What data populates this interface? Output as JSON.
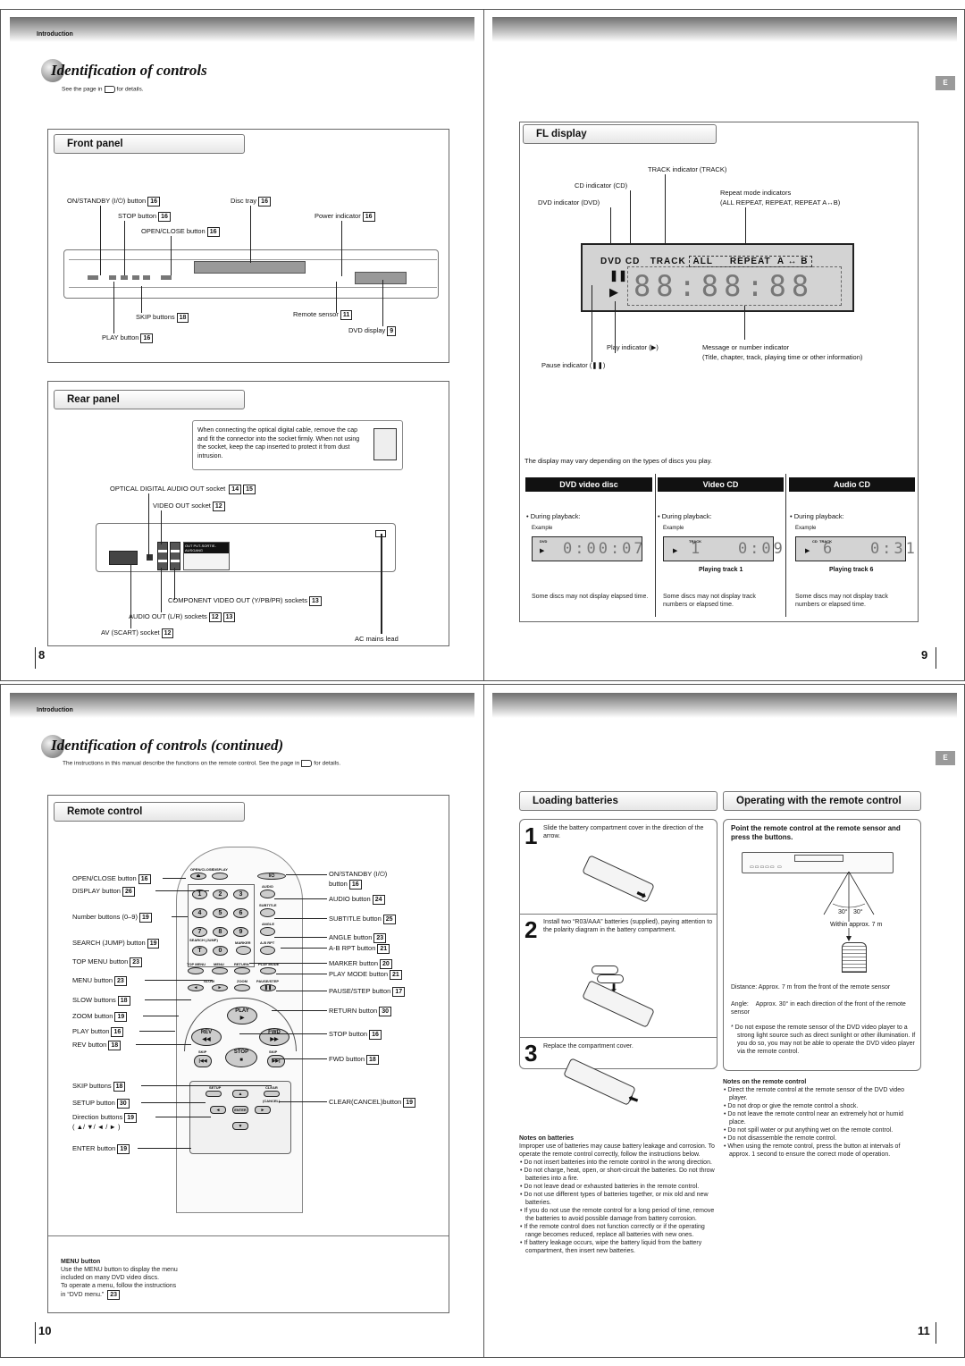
{
  "page8": {
    "header_label": "Introduction",
    "title": "Identification of controls",
    "subtitle_pre": "See the page in",
    "subtitle_post": "for details.",
    "page_number": "8",
    "front_panel": {
      "heading": "Front panel",
      "labels": [
        {
          "text": "ON/STANDBY (I/⏻) button",
          "ref": "16"
        },
        {
          "text": "Disc tray",
          "ref": "16"
        },
        {
          "text": "STOP button",
          "ref": "16"
        },
        {
          "text": "Power indicator",
          "ref": "16"
        },
        {
          "text": "OPEN/CLOSE button",
          "ref": "16"
        },
        {
          "text": "Remote sensor",
          "ref": "11"
        },
        {
          "text": "SKIP buttons",
          "ref": "18"
        },
        {
          "text": "DVD display",
          "ref": "9"
        },
        {
          "text": "PLAY button",
          "ref": "16"
        }
      ]
    },
    "rear_panel": {
      "heading": "Rear panel",
      "note": "When connecting the optical digital cable, remove the cap and fit the connector into the socket firmly. When not using the socket, keep the cap inserted to protect it from dust intrusion.",
      "panel_label": "OUT PUT-SORTIE-AUSGANG",
      "labels": [
        {
          "text": "OPTICAL DIGITAL AUDIO OUT socket",
          "ref": "14",
          "ref2": "15"
        },
        {
          "text": "VIDEO OUT socket",
          "ref": "12"
        },
        {
          "text": "COMPONENT VIDEO OUT (Y/PB/PR) sockets",
          "ref": "13"
        },
        {
          "text": "AUDIO OUT (L/R) sockets",
          "ref": "12",
          "ref2": "13"
        },
        {
          "text": "AV (SCART) socket",
          "ref": "12"
        },
        {
          "text": "AC mains lead"
        }
      ]
    }
  },
  "page9": {
    "page_number": "9",
    "lang_tab": "E",
    "fl_display": {
      "heading": "FL display",
      "indicators": {
        "dvd": "DVD",
        "cd": "CD",
        "track": "TRACK",
        "all": "ALL",
        "repeat": "REPEAT",
        "ab": "A ↔ B",
        "digits": "88:88:88"
      },
      "labels": {
        "track": "TRACK indicator (TRACK)",
        "cd": "CD indicator (CD)",
        "dvd": "DVD indicator (DVD)",
        "repeat1": "Repeat mode indicators",
        "repeat2": "(ALL REPEAT, REPEAT, REPEAT A↔B)",
        "play": "Play indicator (▶)",
        "message1": "Message or number indicator",
        "message2": "(Title, chapter, track, playing time or other information)",
        "pause": "Pause indicator (❚❚)"
      },
      "vary_note": "The display may vary depending on the types of discs you play.",
      "discs": [
        {
          "name": "DVD video disc",
          "during": "During playback:",
          "example": "Example",
          "small_ind": "DVD",
          "display": "0:00:07",
          "caption": "",
          "note": "Some discs may not display elapsed time."
        },
        {
          "name": "Video CD",
          "during": "During playback:",
          "example": "Example",
          "small_ind": "TRACK",
          "display": "1   0:09",
          "caption": "Playing track 1",
          "note": "Some discs may not display track numbers or elapsed time."
        },
        {
          "name": "Audio CD",
          "during": "During playback:",
          "example": "Example",
          "small_ind": "CD  TRACK",
          "display": "6   0:31",
          "caption": "Playing track 6",
          "note": "Some discs may not display track numbers or elapsed time."
        }
      ]
    }
  },
  "page10": {
    "header_label": "Introduction",
    "title": "Identification of controls (continued)",
    "subtitle_pre": "The instructions in this manual describe the functions on the remote control. See the page in",
    "subtitle_post": "for details.",
    "page_number": "10",
    "remote": {
      "heading": "Remote control",
      "left_labels": [
        {
          "text": "OPEN/CLOSE button",
          "ref": "16"
        },
        {
          "text": "DISPLAY button",
          "ref": "26"
        },
        {
          "text": "Number buttons (0–9)",
          "ref": "19"
        },
        {
          "text": "SEARCH (JUMP) button",
          "ref": "19"
        },
        {
          "text": "TOP MENU button",
          "ref": "23"
        },
        {
          "text": "MENU button",
          "ref": "23"
        },
        {
          "text": "SLOW buttons",
          "ref": "18"
        },
        {
          "text": "ZOOM button",
          "ref": "19"
        },
        {
          "text": "PLAY button",
          "ref": "16"
        },
        {
          "text": "REV button",
          "ref": "18"
        },
        {
          "text": "SKIP buttons",
          "ref": "18"
        },
        {
          "text": "SETUP button",
          "ref": "30"
        },
        {
          "text": "Direction buttons",
          "ref": "19",
          "extra": "( ▲/ ▼/ ◄ / ► )"
        },
        {
          "text": "ENTER button",
          "ref": "19"
        }
      ],
      "right_labels": [
        {
          "text": "ON/STANDBY (I/⏻)",
          "text2": "button",
          "ref": "16"
        },
        {
          "text": "AUDIO button",
          "ref": "24"
        },
        {
          "text": "SUBTITLE button",
          "ref": "25"
        },
        {
          "text": "ANGLE button",
          "ref": "23"
        },
        {
          "text": "A-B RPT button",
          "ref": "21"
        },
        {
          "text": "MARKER button",
          "ref": "20"
        },
        {
          "text": "PLAY MODE button",
          "ref": "21"
        },
        {
          "text": "PAUSE/STEP button",
          "ref": "17"
        },
        {
          "text": "RETURN button",
          "ref": "30"
        },
        {
          "text": "STOP button",
          "ref": "16"
        },
        {
          "text": "FWD button",
          "ref": "18"
        },
        {
          "text": "CLEAR(CANCEL)button",
          "ref": "19"
        }
      ],
      "keys": {
        "open_close": "OPEN/CLOSE",
        "display": "DISPLAY",
        "audio": "AUDIO",
        "subtitle": "SUBTITLE",
        "angle": "ANGLE",
        "search": "SEARCH (JUMP)",
        "marker": "MARKER",
        "abrpt": "A-B RPT",
        "topmenu": "TOP MENU",
        "menu": "MENU",
        "return": "RETURN",
        "playmode": "PLAY MODE",
        "slow": "SLOW",
        "zoom": "ZOOM",
        "pausestep": "PAUSE/STEP",
        "play": "PLAY",
        "rev": "REV",
        "fwd": "FWD",
        "stop": "STOP",
        "skip": "SKIP",
        "setup": "SETUP",
        "clear": "CLEAR",
        "cancel": "(CANCEL)",
        "enter": "ENTER",
        "digits": [
          "1",
          "2",
          "3",
          "4",
          "5",
          "6",
          "7",
          "8",
          "9",
          "0"
        ],
        "t": "T",
        "standby": "I/⏻"
      },
      "menu_note": {
        "title": "MENU button",
        "lines": [
          "Use the MENU button to display the menu",
          "included on many DVD video discs.",
          "To operate a menu, follow the instructions",
          "in “DVD menu.”"
        ],
        "ref": "23"
      }
    }
  },
  "page11": {
    "page_number": "11",
    "lang_tab": "E",
    "loading": {
      "heading": "Loading batteries",
      "steps": [
        {
          "num": "1",
          "text": "Slide the battery compartment cover in the direction of the arrow."
        },
        {
          "num": "2",
          "text": "Install two “R03/AAA” batteries (supplied), paying attention to the polarity diagram in the battery compartment."
        },
        {
          "num": "3",
          "text": "Replace the compartment cover."
        }
      ],
      "notes_title": "Notes on batteries",
      "notes_intro": "Improper use of batteries may cause battery leakage and corrosion. To operate the remote control correctly, follow the instructions below.",
      "notes": [
        "Do not insert batteries into the remote control in the wrong direction.",
        "Do not charge, heat, open, or short-circuit the batteries. Do not throw batteries into a fire.",
        "Do not leave dead or exhausted batteries in the remote control.",
        "Do not use different types of batteries together, or mix old and new batteries.",
        "If you do not use the remote control for a long period of time, remove the batteries to avoid possible damage from battery corrosion.",
        "If the remote control does not function correctly or if the operating range becomes reduced, replace all batteries with new ones.",
        "If battery leakage occurs, wipe the battery liquid from the battery compartment, then insert new batteries."
      ]
    },
    "operating": {
      "heading": "Operating with the remote control",
      "instruction": "Point the remote control at the remote sensor and press the buttons.",
      "angle_left": "30°",
      "angle_right": "30°",
      "within": "Within approx. 7 m",
      "distance_label": "Distance:",
      "distance_text": "Approx. 7 m from the front of the remote sensor",
      "angle_label": "Angle:",
      "angle_text": "Approx. 30° in each direction of the front of the remote sensor",
      "caution": "Do not expose the remote sensor of the DVD video player to a strong light source such as direct sunlight or other illumination. If you do so, you may not be able to operate the DVD video player via the remote control.",
      "notes_title": "Notes on the remote control",
      "notes": [
        "Direct the remote control at the remote sensor of the DVD video player.",
        "Do not drop or give the remote control a shock.",
        "Do not leave the remote control near an extremely hot or humid place.",
        "Do not spill water or put anything wet on the remote control.",
        "Do not disassemble the remote control.",
        "When using the remote control, press the button at intervals of approx. 1 second to ensure the correct mode of operation."
      ]
    }
  }
}
